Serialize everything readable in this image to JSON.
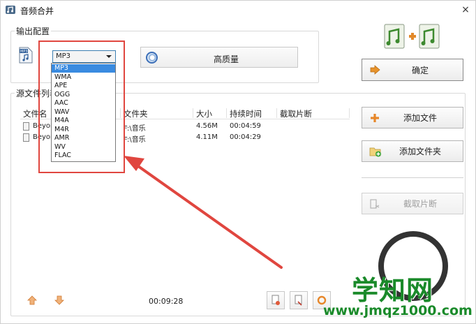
{
  "window": {
    "title": "音频合并",
    "close_glyph": "×"
  },
  "output_config": {
    "label": "输出配置",
    "format_selected": "MP3",
    "format_options": [
      "MP3",
      "WMA",
      "APE",
      "OGG",
      "AAC",
      "WAV",
      "M4A",
      "M4R",
      "AMR",
      "WV",
      "FLAC"
    ],
    "quality_label": "高质量"
  },
  "actions": {
    "confirm_label": "确定",
    "add_file_label": "添加文件",
    "add_folder_label": "添加文件夹",
    "clip_label": "截取片断"
  },
  "file_list": {
    "label": "源文件列表",
    "columns": [
      "文件名",
      "文件夹",
      "大小",
      "持续时间",
      "截取片断"
    ],
    "rows": [
      {
        "name": "Beyon",
        "folder": "F:\\音乐",
        "size": "4.56M",
        "duration": "00:04:59",
        "clip": ""
      },
      {
        "name": "Beyon",
        "folder": "F:\\音乐",
        "size": "4.11M",
        "duration": "00:04:29",
        "clip": ""
      }
    ],
    "total_duration": "00:09:28"
  },
  "watermark": {
    "main": "学知网",
    "url": "www.jmqz1000.com"
  },
  "colors": {
    "accent": "#3a8be0",
    "annotation": "#e0463f",
    "watermark": "#1a8a2a"
  },
  "icons": [
    "app-icon",
    "close-icon",
    "mp3-file-icon",
    "quality-icon",
    "merge-icon",
    "confirm-arrow-icon",
    "add-icon",
    "add-folder-icon",
    "clip-icon",
    "move-up-icon",
    "move-down-icon"
  ]
}
